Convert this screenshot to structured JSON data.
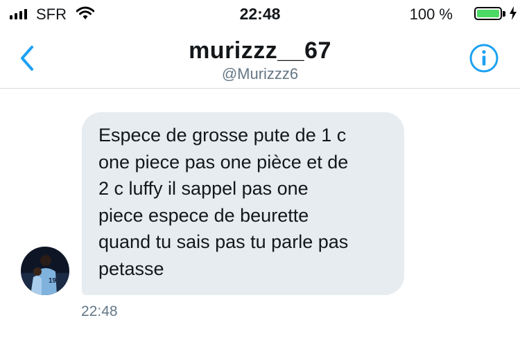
{
  "status_bar": {
    "carrier": "SFR",
    "time": "22:48",
    "battery_percent": "100 %",
    "signal_bars": 4,
    "icons": [
      "signal-bars-icon",
      "wifi-icon",
      "battery-icon",
      "charging-bolt-icon"
    ]
  },
  "header": {
    "title": "murizzz__67",
    "handle": "@Murizzz6",
    "icons": [
      "back-chevron-icon",
      "info-icon"
    ]
  },
  "conversation": {
    "messages": [
      {
        "text": "Espece de grosse pute de 1 c\none piece pas one pièce et de\n2 c luffy il sappel pas one\npiece espece de beurette\nquand tu sais pas tu parle pas\npetasse",
        "time": "22:48",
        "incoming": true
      }
    ]
  },
  "colors": {
    "accent": "#1da1f2",
    "bubble": "#e6ecf0",
    "secondary_text": "#657786",
    "battery": "#4cd964"
  }
}
